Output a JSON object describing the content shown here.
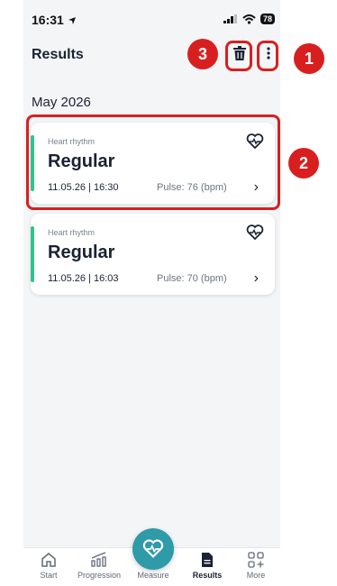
{
  "status": {
    "time": "16:31",
    "battery": "78"
  },
  "header": {
    "title": "Results"
  },
  "section": {
    "month": "May 2026"
  },
  "records": [
    {
      "category": "Heart rhythm",
      "result": "Regular",
      "datetime": "11.05.26 | 16:30",
      "pulse": "Pulse: 76 (bpm)"
    },
    {
      "category": "Heart rhythm",
      "result": "Regular",
      "datetime": "11.05.26 | 16:03",
      "pulse": "Pulse: 70 (bpm)"
    }
  ],
  "tabs": [
    {
      "label": "Start",
      "icon": "home-icon"
    },
    {
      "label": "Progression",
      "icon": "trend-icon"
    },
    {
      "label": "Measure",
      "icon": "heart-pulse-icon"
    },
    {
      "label": "Results",
      "icon": "document-icon"
    },
    {
      "label": "More",
      "icon": "grid-plus-icon"
    }
  ],
  "annotations": {
    "badge1": "1",
    "badge2": "2",
    "badge3": "3"
  },
  "colors": {
    "accent": "#2f9aa8",
    "regular": "#2fc48c",
    "annotation": "#d81f1f"
  }
}
